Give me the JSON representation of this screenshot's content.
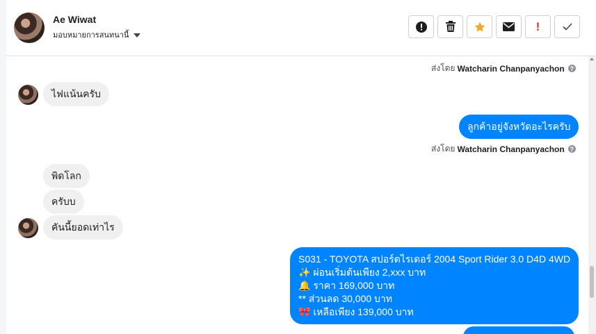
{
  "contact": {
    "name": "Ae Wiwat",
    "assign_label": "มอบหมายการสนทนานี้"
  },
  "actions": {
    "report": "!",
    "spam": "!"
  },
  "messages": {
    "sent_by_prefix": "ส่งโดย",
    "agent_name": "Watcharin Chanpanyachon",
    "in1": "ไฟแน้นครับ",
    "out1": "ลูกค้าอยู่จังหวัดอะไรครับ",
    "in2": "พิดโลก",
    "in3": "ครับบ",
    "in4": "คันนี้ยอดเท่าไร",
    "out2_lines": [
      "S031 - TOYOTA สปอร์ตไรเดอร์ 2004 Sport Rider 3.0 D4D 4WD",
      "✨ ผ่อนเริ่มต้นเพียง 2,xxx บาท",
      "🔔  ราคา 169,000 บาท",
      "** ส่วนลด 30,000 บาท",
      "🎀 เหลือเพียง 139,000 บาท"
    ]
  },
  "colors": {
    "outgoing": "#0084ff",
    "incoming": "#f1f0f0"
  }
}
